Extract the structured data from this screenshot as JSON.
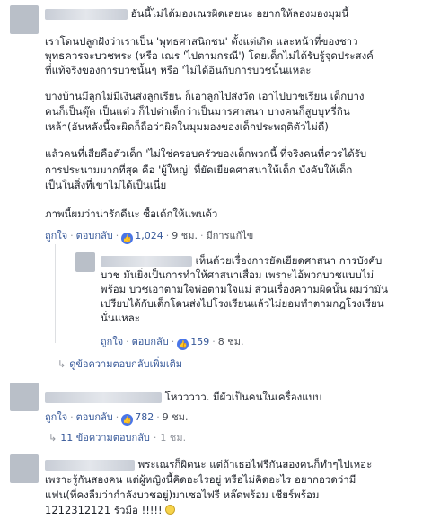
{
  "comments": [
    {
      "text_lines": [
        "อันนี้ไม่ได้มองเณรผิดเลยนะ อยากให้ลองมองมุมนี้"
      ],
      "paragraphs": [
        [
          "เราโดนปลูกฝังว่าเราเป็น 'พุทธศาสนิกชน' ตั้งแต่เกิด และหน้าที่ของชาว",
          "พุทธควรจะบวชพระ (หรือ เณร 'ไปตามกรณี') โดยเด็กไม่ได้รับรู้จุดประสงค์",
          "ที่แท้จริงของการบวชนั้นๆ หรือ 'ไม่ได้อินกับการบวชนั้นแหละ"
        ],
        [
          "บางบ้านมีลูกไม่มีเงินส่งลูกเรียน ก็เอาลูกไปส่งวัด เอาไปบวชเรียน เด็กบาง",
          "คนก็เป็นตุ๊ด เป็นแต๋ว ก็ไปด่าเด็กว่าเป็นมารศาสนา บางคนก็สูบบุหรี่กิน",
          "เหล้า(อันหลังนี้จะผิดก็ถือว่าผิดในมุมมองของเด็กประพฤติตัวไม่ดี)"
        ],
        [
          "แล้วคนที่เสียคือตัวเด็ก 'ไม่ใช่ครอบครัวของเด็กพวกนี้ ที่จริงคนที่ควรได้รับ",
          "การประนามมากที่สุด คือ 'ผู้ใหญ่' ที่ยัดเยียดศาสนาให้เด็ก บังคับให้เด็ก",
          "เป็นในสิ่งที่เขาไม่ได้เป็นเนี่ย"
        ],
        [
          "ภาพนี้ผมว่าน่ารักดีนะ ซื้อเด้กให้แพนด้ว"
        ]
      ],
      "like": "ถูกใจ",
      "reply": "ตอบกลับ",
      "count": "1,024",
      "time": "9 ชม.",
      "edited": "มีการแก้ไข"
    },
    {
      "text_lines": [
        "เห็นด้วยเรื่องการยัดเยียดศาสนา การบังคับ",
        "บวช มันยิ่งเป็นการทำให้ศาสนาเสื่อม เพราะไอ้พวกบวชแบบไม่",
        "พร้อม บวชเอาตามใจพ่อตามใจแม่ ส่วนเรื่องความผิดนั้น ผมว่ามัน",
        "เปรียบได้กับเด็กโดนส่งไปโรงเรียนแล้วไม่ยอมทำตามกฎโรงเรียน",
        "นั่นแหละ"
      ],
      "like": "ถูกใจ",
      "reply": "ตอบกลับ",
      "count": "159",
      "time": "8 ชม.",
      "more": "ดูข้อความตอบกลับเพิ่มเติม"
    },
    {
      "text_lines": [
        "โหววววว. มีผัวเป็นคนในเครื่องแบบ"
      ],
      "like": "ถูกใจ",
      "reply": "ตอบกลับ",
      "count": "782",
      "time": "9 ชม.",
      "more": "11 ข้อความตอบกลับ",
      "more_time": "1 ชม."
    },
    {
      "text_lines": [
        "พระเณรก็ผิดนะ แต่ถ้าเธอไฟรีกันสองคนก็ทำๆไปเหอะ",
        "เพราะรู้กันสองคน แต่ผู้หญิงนี้คิดอะไรอยู่ หรือไม่คิดอะไร อยากอวดว่ามี",
        "แฟน(ที่คงลืมว่ากำลังบวชอยู่)มาเซอไฟรี หล๊ดพร้อม เชียร์พร้อม",
        "1212312121 รัวมือ !!!!!"
      ]
    }
  ],
  "icons": {
    "reply_arrow": "reply-arrow-icon",
    "like_badge": "thumbs-up-icon",
    "emoji": "smiley-icon"
  },
  "colors": {
    "link": "#365899",
    "like_badge": "#4a76e8"
  }
}
